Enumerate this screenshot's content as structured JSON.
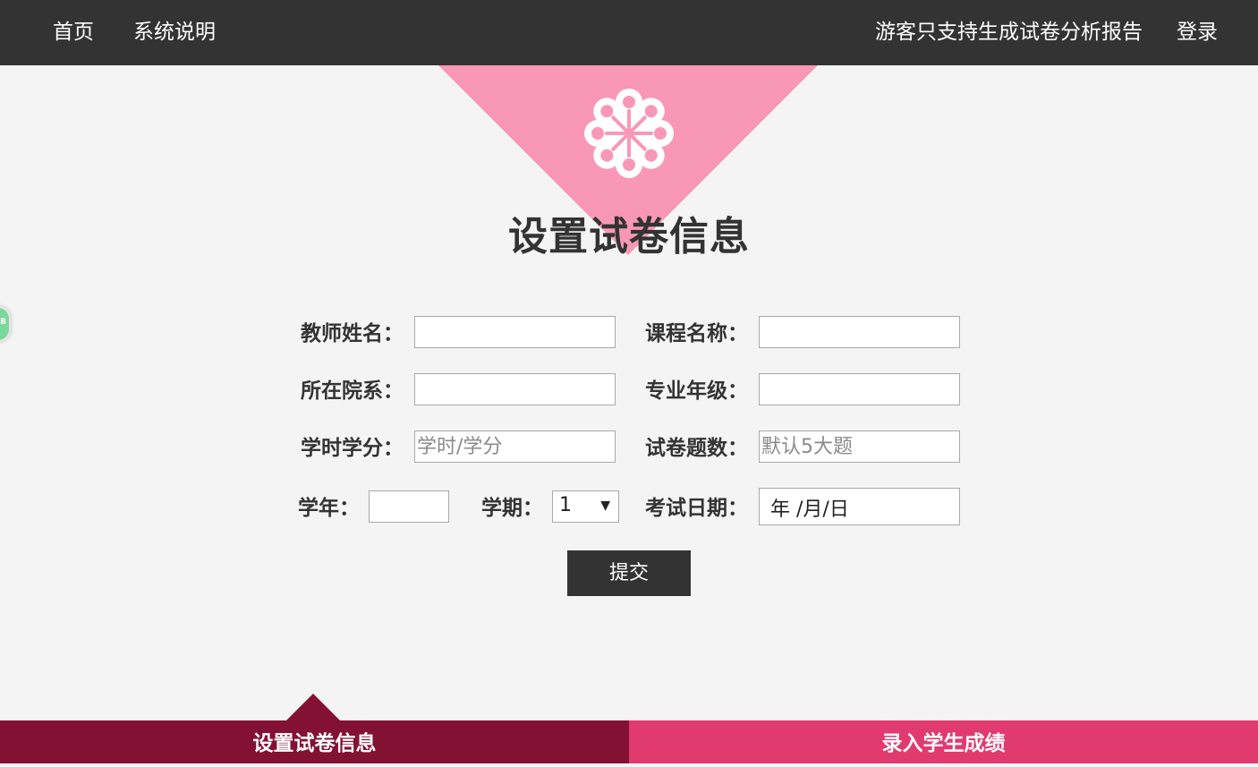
{
  "nav": {
    "home": "首页",
    "manual": "系统说明",
    "guest_notice": "游客只支持生成试卷分析报告",
    "login": "登录"
  },
  "page_title": "设置试卷信息",
  "form": {
    "teacher_name": {
      "label": "教师姓名：",
      "value": ""
    },
    "course_name": {
      "label": "课程名称：",
      "value": ""
    },
    "department": {
      "label": "所在院系：",
      "value": ""
    },
    "major_grade": {
      "label": "专业年级：",
      "value": ""
    },
    "hours_credits": {
      "label": "学时学分：",
      "placeholder": "学时/学分"
    },
    "question_count": {
      "label": "试卷题数：",
      "placeholder": "默认5大题"
    },
    "year": {
      "label": "学年：",
      "value": ""
    },
    "semester": {
      "label": "学期：",
      "selected": "1"
    },
    "exam_date": {
      "label": "考试日期：",
      "value": "年 /月/日"
    },
    "submit": "提交"
  },
  "steps": {
    "step1": "设置试卷信息",
    "step2": "录入学生成绩"
  },
  "colors": {
    "nav_bg": "#333333",
    "triangle": "#f898b6",
    "step_active": "#831133",
    "step_inactive": "#e03a6f"
  },
  "icons": {
    "header_emblem": "flower-icon",
    "semester_dropdown": "dropdown-arrow-icon"
  }
}
